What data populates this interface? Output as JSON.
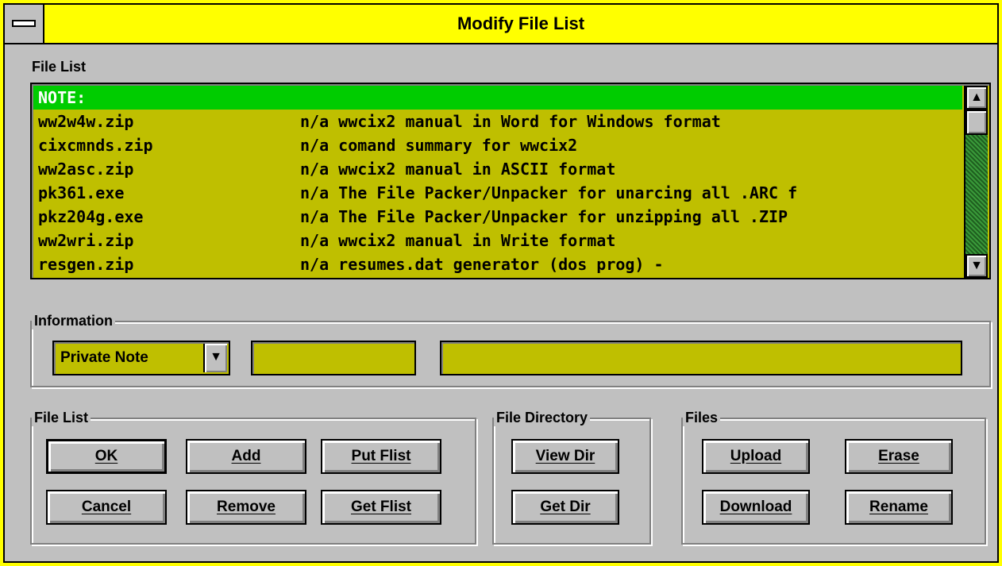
{
  "window": {
    "title": "Modify File List"
  },
  "file_list_label": "File List",
  "file_list": {
    "rows": [
      {
        "name": "NOTE:",
        "desc": ""
      },
      {
        "name": "ww2w4w.zip",
        "desc": "n/a wwcix2 manual in Word for Windows format"
      },
      {
        "name": "cixcmnds.zip",
        "desc": "n/a comand summary for wwcix2"
      },
      {
        "name": "ww2asc.zip",
        "desc": "n/a wwcix2 manual in ASCII format"
      },
      {
        "name": "pk361.exe",
        "desc": "n/a The File Packer/Unpacker for unarcing all .ARC f"
      },
      {
        "name": "pkz204g.exe",
        "desc": "n/a The File Packer/Unpacker for unzipping all .ZIP"
      },
      {
        "name": "ww2wri.zip",
        "desc": "n/a wwcix2 manual in Write format"
      },
      {
        "name": "resgen.zip",
        "desc": "n/a resumes.dat generator (dos prog) -"
      }
    ],
    "selected_index": 0
  },
  "information": {
    "label": "Information",
    "type_select": "Private Note",
    "field1_value": "",
    "field2_value": ""
  },
  "groups": {
    "file_list": {
      "label": "File List",
      "ok": "OK",
      "add": "Add",
      "put_flist": "Put Flist",
      "cancel": "Cancel",
      "remove": "Remove",
      "get_flist": "Get Flist"
    },
    "file_directory": {
      "label": "File Directory",
      "view_dir": "View Dir",
      "get_dir": "Get Dir"
    },
    "files": {
      "label": "Files",
      "upload": "Upload",
      "erase": "Erase",
      "download": "Download",
      "rename": "Rename"
    }
  },
  "icons": {
    "system_menu": "system-menu-icon",
    "scroll_up": "up-arrow-icon",
    "scroll_down": "down-arrow-icon",
    "dropdown": "dropdown-arrow-icon"
  },
  "colors": {
    "title_bar": "#ffff00",
    "dialog_bg": "#c0c0c0",
    "field_bg": "#bfbf00",
    "selection": "#00cc00"
  }
}
